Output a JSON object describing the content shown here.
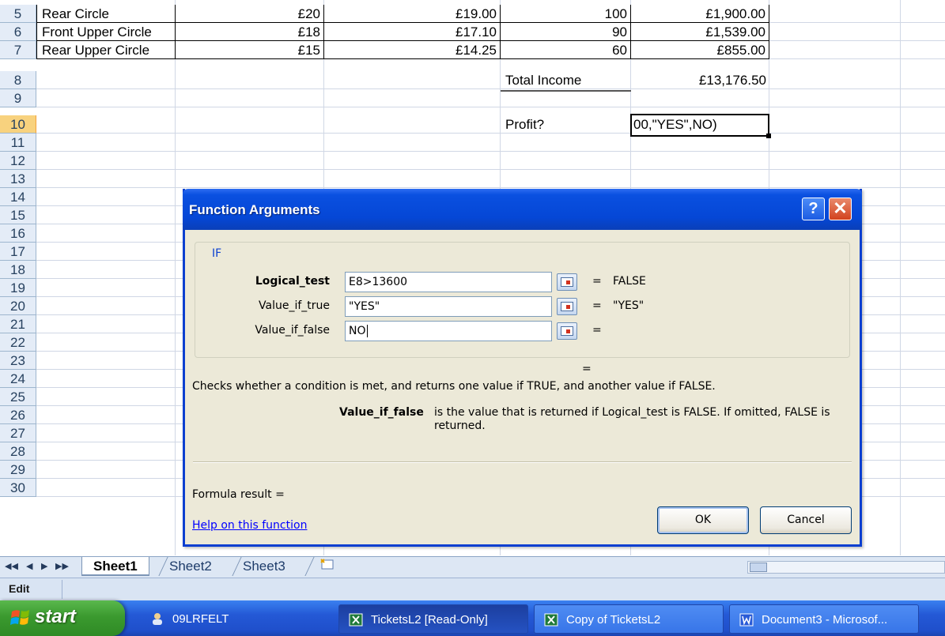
{
  "sheet": {
    "rows": [
      {
        "num": "5",
        "name": "Rear Circle",
        "price": "£20",
        "discounted": "£19.00",
        "qty": "100",
        "income": "£1,900.00"
      },
      {
        "num": "6",
        "name": "Front Upper Circle",
        "price": "£18",
        "discounted": "£17.10",
        "qty": "90",
        "income": "£1,539.00"
      },
      {
        "num": "7",
        "name": "Rear Upper Circle",
        "price": "£15",
        "discounted": "£14.25",
        "qty": "60",
        "income": "£855.00"
      }
    ],
    "row_numbers": [
      "8",
      "9",
      "10",
      "11",
      "12",
      "13",
      "14",
      "15",
      "16",
      "17",
      "18",
      "19",
      "20",
      "21",
      "22",
      "23",
      "24",
      "25",
      "26",
      "27",
      "28",
      "29",
      "30"
    ],
    "total_income_label": "Total Income",
    "total_income_value": "£13,176.50",
    "profit_label": "Profit?",
    "active_cell_text": "00,\"YES\",NO)"
  },
  "tabs": {
    "sheet1": "Sheet1",
    "sheet2": "Sheet2",
    "sheet3": "Sheet3"
  },
  "status": {
    "mode": "Edit"
  },
  "taskbar": {
    "start": "start",
    "items": [
      "09LRFELT",
      "TicketsL2 [Read-Only]",
      "Copy of TicketsL2",
      "Document3 - Microsof..."
    ]
  },
  "dialog": {
    "title": "Function Arguments",
    "help_glyph": "?",
    "close_glyph": "✕",
    "function_name": "IF",
    "args": [
      {
        "label": "Logical_test",
        "value": "E8>13600",
        "eq": "=",
        "result": "FALSE"
      },
      {
        "label": "Value_if_true",
        "value": "\"YES\"",
        "eq": "=",
        "result": "\"YES\""
      },
      {
        "label": "Value_if_false",
        "value": "NO",
        "eq": "=",
        "result": ""
      }
    ],
    "overall_eq": "=",
    "description": "Checks whether a condition is met, and returns one value if TRUE, and another value if FALSE.",
    "arg_desc_name": "Value_if_false",
    "arg_desc_text": "is the value that is returned if Logical_test is FALSE. If omitted, FALSE is returned.",
    "formula_result": "Formula result =",
    "help_link": "Help on this function",
    "ok": "OK",
    "cancel": "Cancel"
  }
}
